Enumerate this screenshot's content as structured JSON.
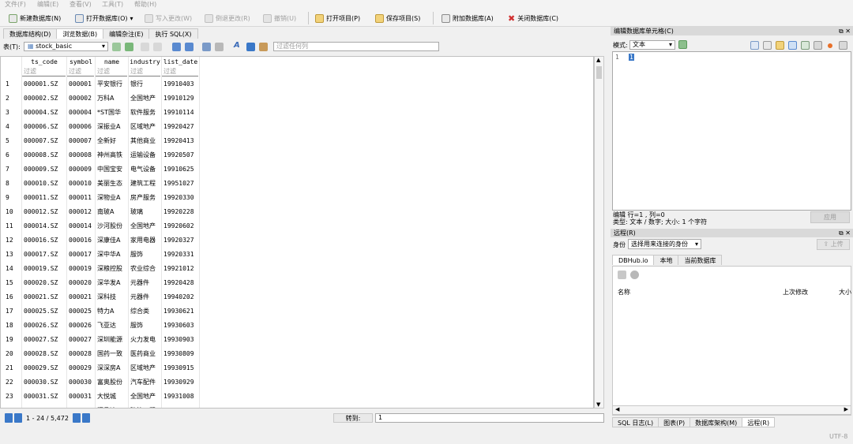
{
  "menu": [
    "文件(F)",
    "编辑(E)",
    "查看(V)",
    "工具(T)",
    "帮助(H)"
  ],
  "toolbar": {
    "new_db": "新建数据库(N)",
    "open_db": "打开数据库(O)",
    "write_changes": "写入更改(W)",
    "revert_changes": "倒退更改(R)",
    "undo": "撤销(U)",
    "open_project": "打开项目(P)",
    "save_project": "保存项目(S)",
    "attach_db": "附加数据库(A)",
    "close_db": "关闭数据库(C)"
  },
  "main_tabs": [
    "数据库结构(D)",
    "浏览数据(B)",
    "编辑杂注(E)",
    "执行 SQL(X)"
  ],
  "browse": {
    "table_label": "表(T):",
    "table_name": "stock_basic",
    "filter_all_placeholder": "过滤任何列"
  },
  "grid": {
    "columns": [
      "ts_code",
      "symbol",
      "name",
      "industry",
      "list_date"
    ],
    "filter_placeholder": "过滤",
    "rows": [
      [
        "1",
        "000001.SZ",
        "000001",
        "平安银行",
        "银行",
        "19910403"
      ],
      [
        "2",
        "000002.SZ",
        "000002",
        "万科A",
        "全国地产",
        "19910129"
      ],
      [
        "3",
        "000004.SZ",
        "000004",
        "*ST国华",
        "软件服务",
        "19910114"
      ],
      [
        "4",
        "000006.SZ",
        "000006",
        "深振业A",
        "区域地产",
        "19920427"
      ],
      [
        "5",
        "000007.SZ",
        "000007",
        "全新好",
        "其他商业",
        "19920413"
      ],
      [
        "6",
        "000008.SZ",
        "000008",
        "神州高铁",
        "运输设备",
        "19920507"
      ],
      [
        "7",
        "000009.SZ",
        "000009",
        "中国宝安",
        "电气设备",
        "19910625"
      ],
      [
        "8",
        "000010.SZ",
        "000010",
        "美丽生态",
        "建筑工程",
        "19951027"
      ],
      [
        "9",
        "000011.SZ",
        "000011",
        "深物业A",
        "房产服务",
        "19920330"
      ],
      [
        "10",
        "000012.SZ",
        "000012",
        "南玻A",
        "玻璃",
        "19920228"
      ],
      [
        "11",
        "000014.SZ",
        "000014",
        "沙河股份",
        "全国地产",
        "19920602"
      ],
      [
        "12",
        "000016.SZ",
        "000016",
        "深康佳A",
        "家用电器",
        "19920327"
      ],
      [
        "13",
        "000017.SZ",
        "000017",
        "深中华A",
        "服饰",
        "19920331"
      ],
      [
        "14",
        "000019.SZ",
        "000019",
        "深粮控股",
        "农业综合",
        "19921012"
      ],
      [
        "15",
        "000020.SZ",
        "000020",
        "深华发A",
        "元器件",
        "19920428"
      ],
      [
        "16",
        "000021.SZ",
        "000021",
        "深科技",
        "元器件",
        "19940202"
      ],
      [
        "17",
        "000025.SZ",
        "000025",
        "特力A",
        "综合类",
        "19930621"
      ],
      [
        "18",
        "000026.SZ",
        "000026",
        "飞亚达",
        "服饰",
        "19930603"
      ],
      [
        "19",
        "000027.SZ",
        "000027",
        "深圳能源",
        "火力发电",
        "19930903"
      ],
      [
        "20",
        "000028.SZ",
        "000028",
        "国药一致",
        "医药商业",
        "19930809"
      ],
      [
        "21",
        "000029.SZ",
        "000029",
        "深深房A",
        "区域地产",
        "19930915"
      ],
      [
        "22",
        "000030.SZ",
        "000030",
        "富奥股份",
        "汽车配件",
        "19930929"
      ],
      [
        "23",
        "000031.SZ",
        "000031",
        "大悦城",
        "全国地产",
        "19931008"
      ],
      [
        "24",
        "000032.SZ",
        "000032",
        "深桑达A",
        "建筑工程",
        "19931028"
      ]
    ]
  },
  "status": {
    "range": "1 - 24 / 5,472",
    "goto_label": "转到:",
    "goto_value": "1"
  },
  "edit_cell": {
    "title": "编辑数据库单元格(C)",
    "mode_label": "模式:",
    "mode_value": "文本",
    "line_number": "1",
    "cursor_char": "1",
    "info_line1": "编辑 行=1 , 列=0",
    "info_line2": "类型: 文本 / 数字; 大小: 1 个字符",
    "apply": "应用"
  },
  "remote": {
    "title": "远程(R)",
    "identity_label": "身份",
    "identity_value": "选择用来连接的身份",
    "upload": "上传",
    "tabs": [
      "DBHub.io",
      "本地",
      "当前数据库"
    ],
    "col_name": "名称",
    "col_modified": "上次修改",
    "col_size": "大小"
  },
  "bottom_tabs": [
    "SQL 日志(L)",
    "图表(P)",
    "数据库架构(M)",
    "远程(R)"
  ],
  "encoding": "UTF-8",
  "colors": {
    "accent": "#3a78c8",
    "header_bg": "#d9d9d9",
    "disabled_text": "#9a9a9a"
  }
}
